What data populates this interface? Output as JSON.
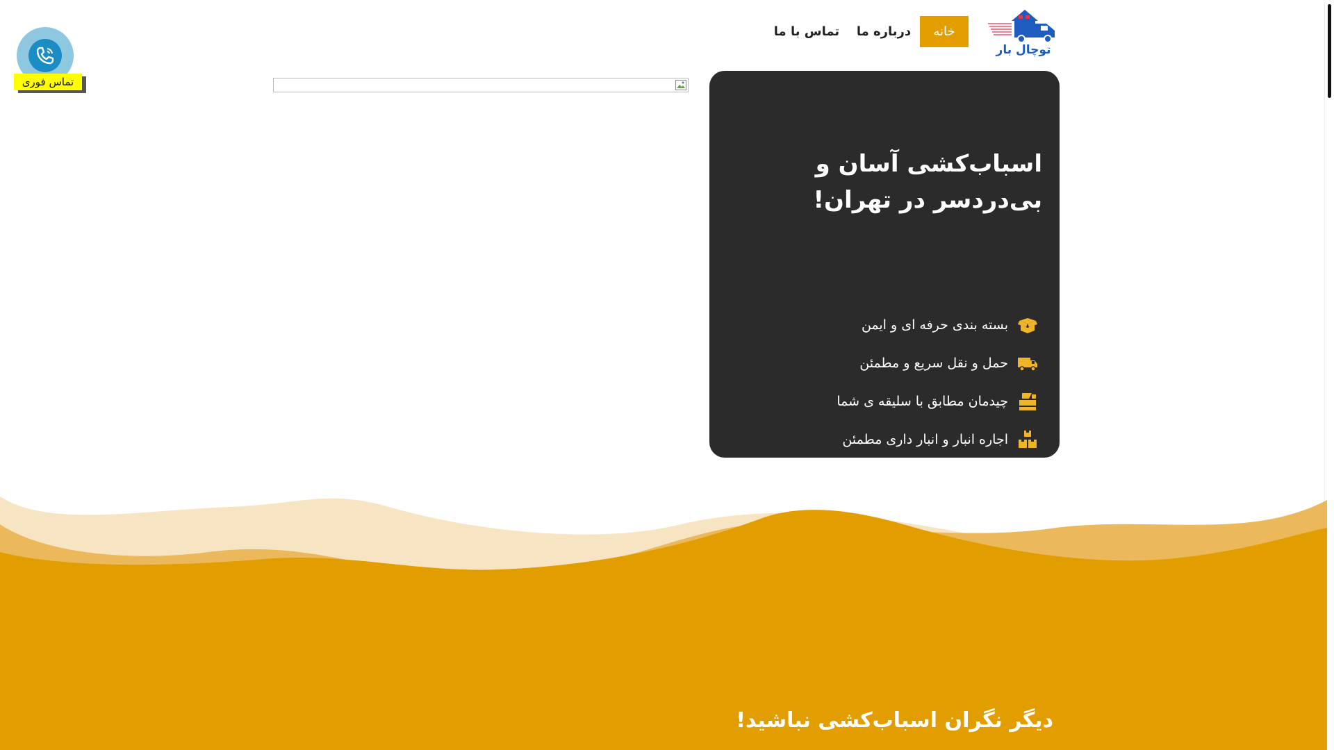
{
  "header": {
    "logo_text": "توچال بار",
    "nav": [
      {
        "label": "خانه"
      },
      {
        "label": "درباره ما"
      },
      {
        "label": "تماس با ما"
      }
    ]
  },
  "call_widget": {
    "label": "تماس فوری"
  },
  "hero": {
    "title": "اسباب‌کشی آسان و بی‌دردسر در تهران!",
    "features": [
      {
        "text": "بسته بندی حرفه ای و ایمن",
        "icon": "box-open-icon"
      },
      {
        "text": "حمل و نقل سریع و مطمئن",
        "icon": "truck-icon"
      },
      {
        "text": "چیدمان مطابق با سلیقه ی شما",
        "icon": "box-arrange-icon"
      },
      {
        "text": "اجاره انبار و انبار داری مطمئن",
        "icon": "warehouse-boxes-icon"
      }
    ]
  },
  "section2": {
    "title": "دیگر نگران اسباب‌کشی نباشید!"
  },
  "colors": {
    "accent": "#e29d00",
    "card_bg": "#2b2b2b",
    "logo_blue": "#1f5cc0",
    "call_yellow": "#ffff00"
  }
}
